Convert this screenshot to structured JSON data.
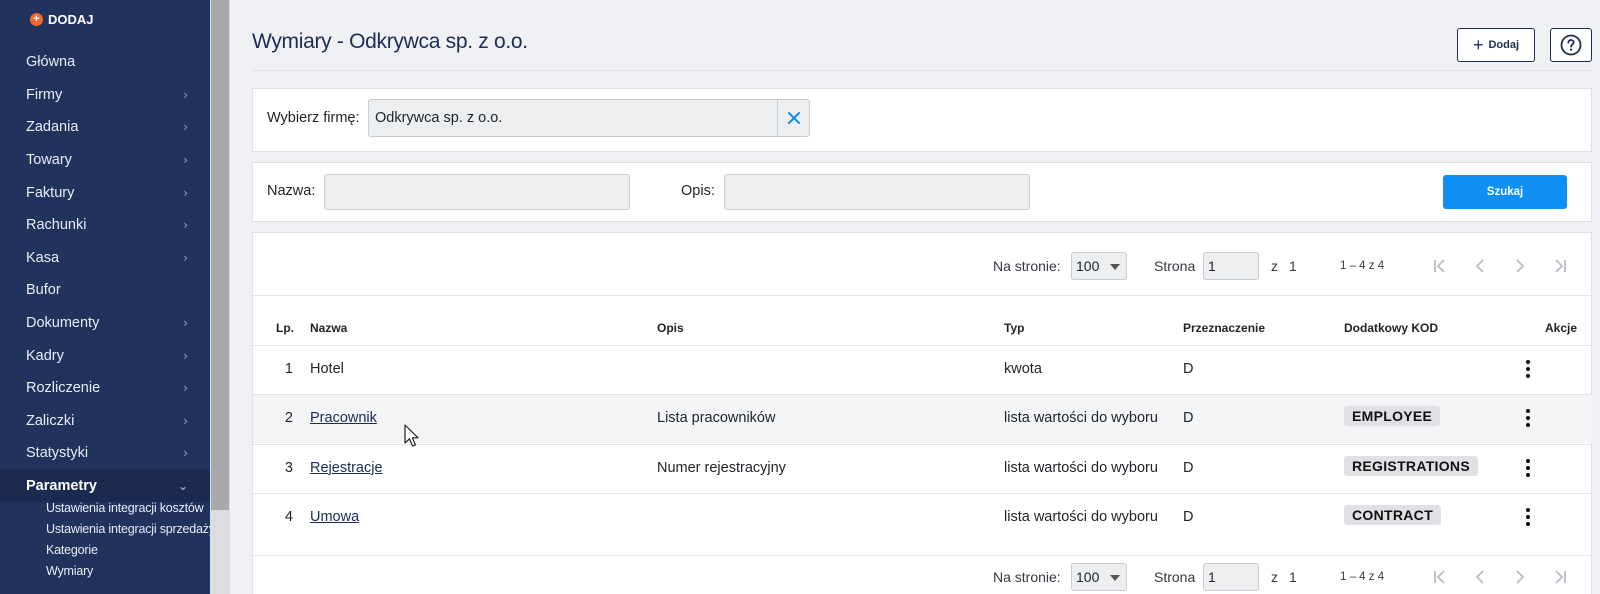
{
  "sidebar": {
    "add_label": "DODAJ",
    "items": [
      {
        "label": "Główna",
        "chevron": false
      },
      {
        "label": "Firmy",
        "chevron": true
      },
      {
        "label": "Zadania",
        "chevron": true
      },
      {
        "label": "Towary",
        "chevron": true
      },
      {
        "label": "Faktury",
        "chevron": true
      },
      {
        "label": "Rachunki",
        "chevron": true
      },
      {
        "label": "Kasa",
        "chevron": true
      },
      {
        "label": "Bufor",
        "chevron": false
      },
      {
        "label": "Dokumenty",
        "chevron": true
      },
      {
        "label": "Kadry",
        "chevron": true
      },
      {
        "label": "Rozliczenie",
        "chevron": true
      },
      {
        "label": "Zaliczki",
        "chevron": true
      },
      {
        "label": "Statystyki",
        "chevron": true
      },
      {
        "label": "Parametry",
        "chevron": true,
        "active": true
      }
    ],
    "subitems": [
      {
        "label": "Ustawienia integracji kosztów"
      },
      {
        "label": "Ustawienia integracji sprzedaży"
      },
      {
        "label": "Kategorie"
      },
      {
        "label": "Wymiary"
      }
    ]
  },
  "header": {
    "title": "Wymiary - Odkrywca sp. z o.o.",
    "add_label": "Dodaj",
    "help_icon": "question-circle-icon"
  },
  "firm_filter": {
    "label": "Wybierz firmę:",
    "value": "Odkrywca sp. z o.o."
  },
  "search": {
    "name_label": "Nazwa:",
    "name_value": "",
    "desc_label": "Opis:",
    "desc_value": "",
    "button_label": "Szukaj"
  },
  "pager": {
    "per_page_label": "Na stronie:",
    "per_page_value": "100",
    "page_label": "Strona",
    "page_value": "1",
    "of_label": "z",
    "total_pages": "1",
    "range_text": "1 – 4 z 4"
  },
  "table": {
    "columns": [
      "Lp.",
      "Nazwa",
      "Opis",
      "Typ",
      "Przeznaczenie",
      "Dodatkowy KOD",
      "Akcje"
    ],
    "rows": [
      {
        "lp": "1",
        "name": "Hotel",
        "link": false,
        "desc": "",
        "type": "kwota",
        "purpose": "D",
        "code": ""
      },
      {
        "lp": "2",
        "name": "Pracownik",
        "link": true,
        "desc": "Lista pracowników",
        "type": "lista wartości do wyboru",
        "purpose": "D",
        "code": "EMPLOYEE"
      },
      {
        "lp": "3",
        "name": "Rejestracje",
        "link": true,
        "desc": "Numer rejestracyjny",
        "type": "lista wartości do wyboru",
        "purpose": "D",
        "code": "REGISTRATIONS"
      },
      {
        "lp": "4",
        "name": "Umowa",
        "link": true,
        "desc": "",
        "type": "lista wartości do wyboru",
        "purpose": "D",
        "code": "CONTRACT"
      }
    ]
  },
  "colors": {
    "sidebar_bg": "#21325c",
    "accent": "#0f8ff2",
    "title": "#1d2c55",
    "add_dot": "#f26a2a"
  }
}
